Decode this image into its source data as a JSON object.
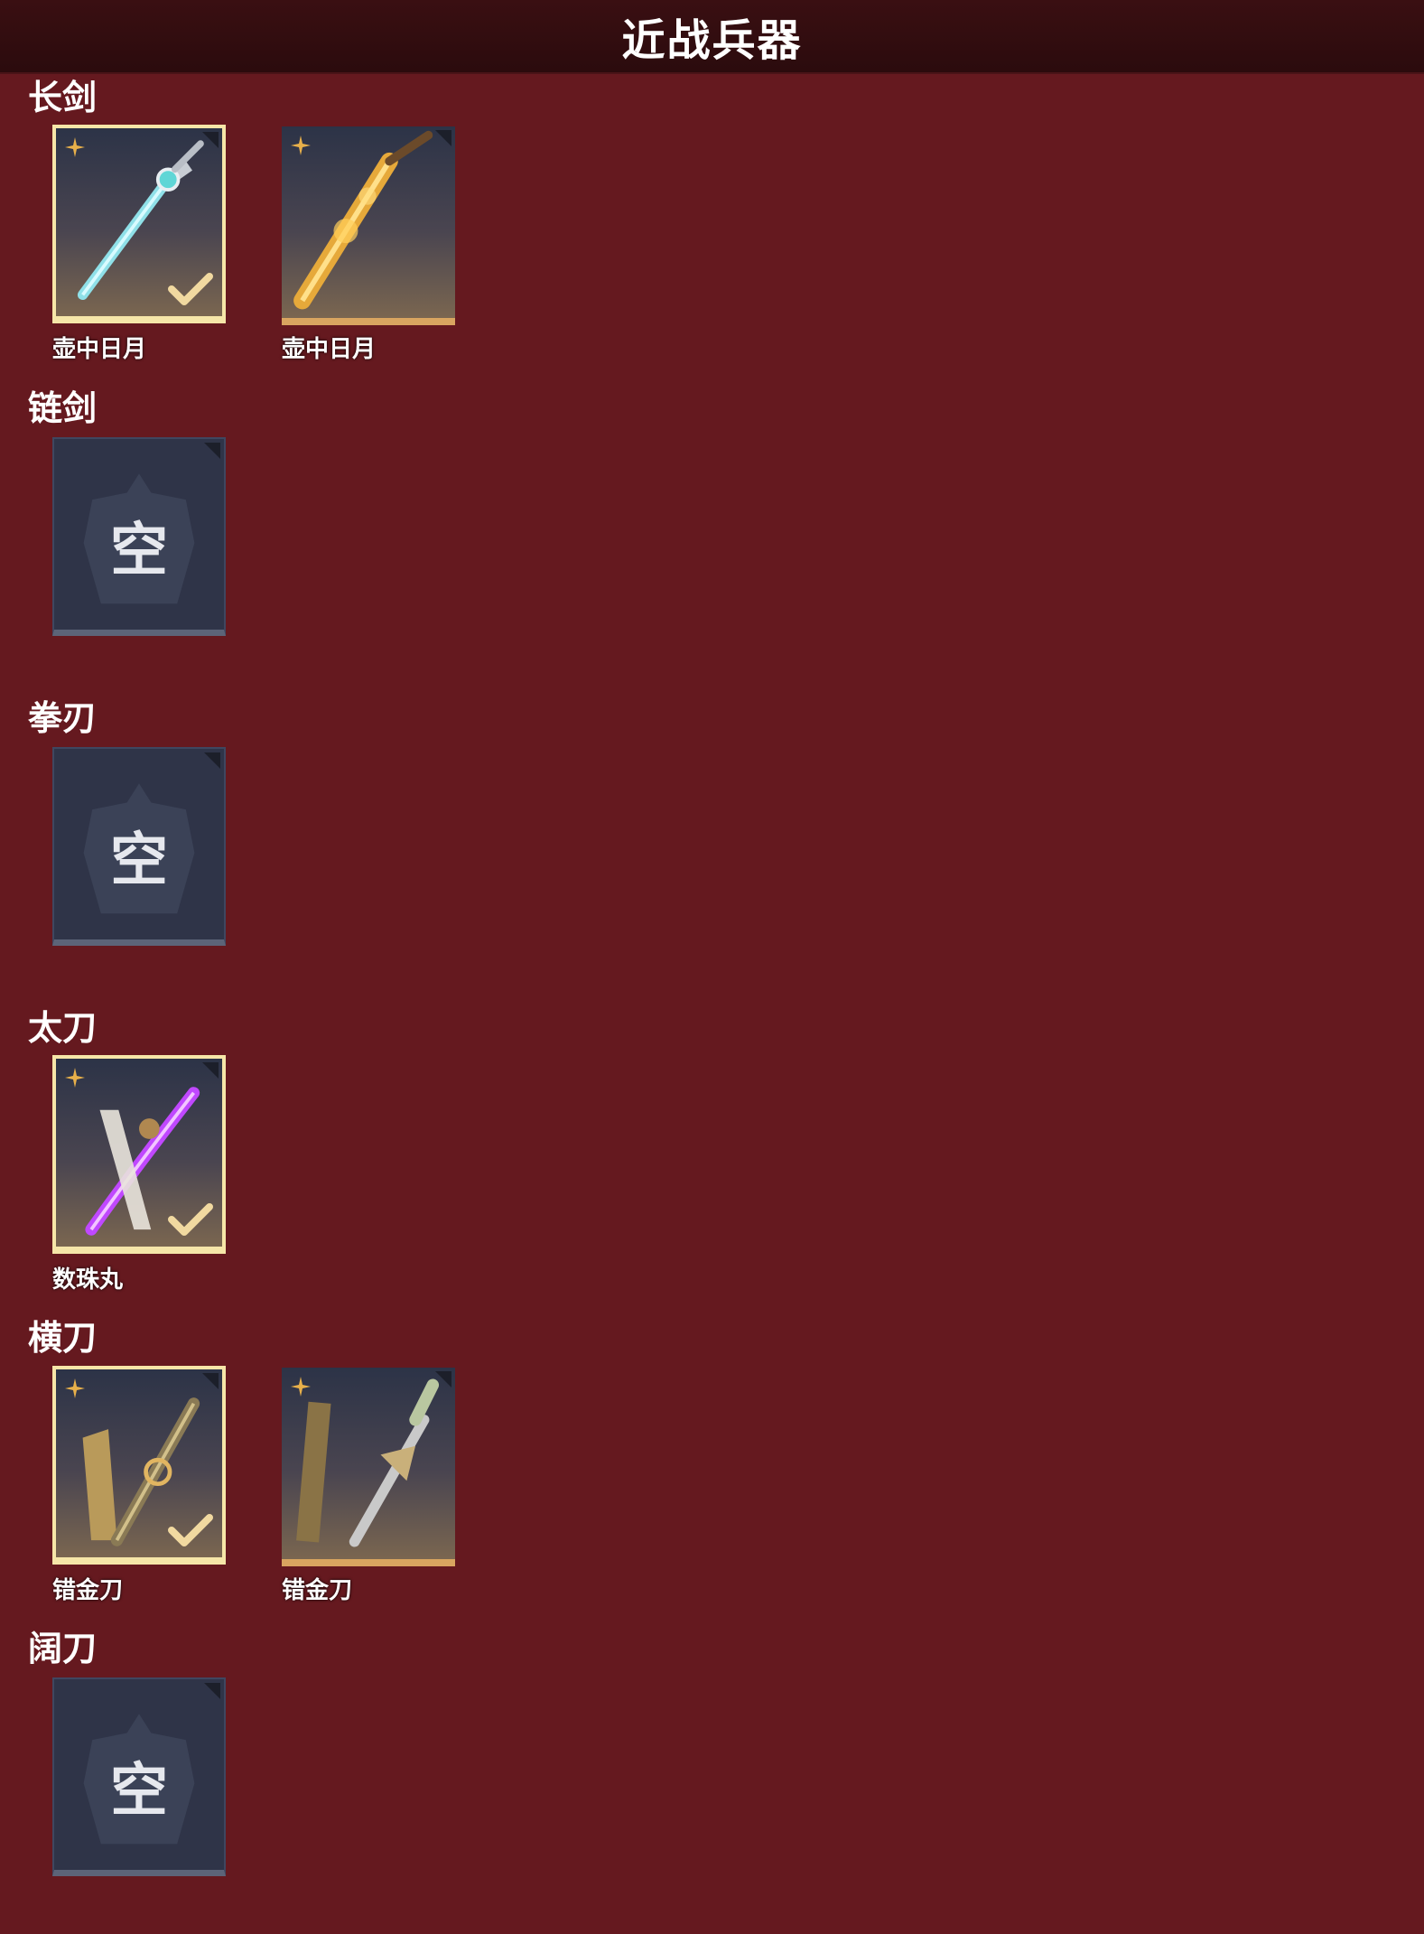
{
  "header": {
    "title": "近战兵器"
  },
  "sections": [
    {
      "label": "长剑",
      "items": [
        {
          "name": "壶中日月",
          "selected": true,
          "art": "teal-sword"
        },
        {
          "name": "壶中日月",
          "selected": false,
          "art": "gold-sword"
        }
      ]
    },
    {
      "label": "链剑",
      "items": [
        {
          "empty_text": "空"
        }
      ]
    },
    {
      "label": "拳刃",
      "items": [
        {
          "empty_text": "空"
        }
      ]
    },
    {
      "label": "太刀",
      "items": [
        {
          "name": "数珠丸",
          "selected": true,
          "art": "purple-katana"
        }
      ]
    },
    {
      "label": "横刀",
      "items": [
        {
          "name": "错金刀",
          "selected": true,
          "art": "gold-sheath-blade"
        },
        {
          "name": "错金刀",
          "selected": false,
          "art": "gold-dagger"
        }
      ]
    },
    {
      "label": "阔刀",
      "items": [
        {
          "empty_text": "空"
        }
      ]
    }
  ],
  "icons": {
    "rarity": "star-icon",
    "equipped": "check-icon"
  },
  "colors": {
    "background": "#65191f",
    "header": "#2b0b0d",
    "selected_border": "#f6e6a8",
    "empty_slot": "#2f3448"
  }
}
